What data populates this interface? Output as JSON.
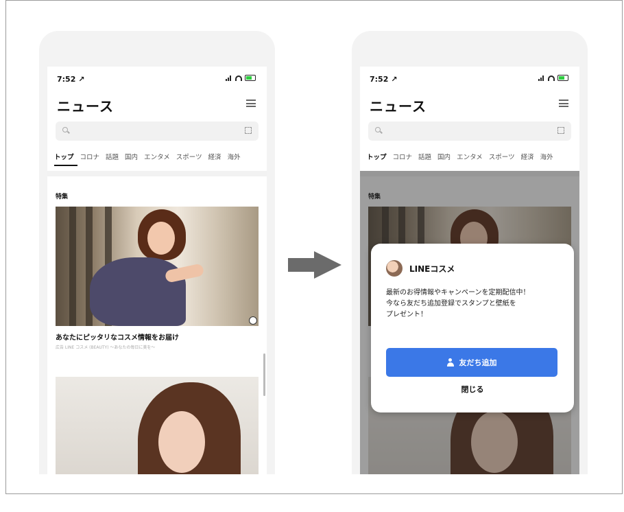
{
  "left_phone": {
    "time": "7:52",
    "title": "ニュース",
    "tabs": [
      "トップ",
      "コロナ",
      "話題",
      "国内",
      "エンタメ",
      "スポーツ",
      "経済",
      "海外"
    ],
    "active_tab": "トップ",
    "section_label": "特集",
    "caption": "あなたにピッタリなコスメ情報をお届け",
    "source": "広告 LINE コスメ (BEAUTY) 〜あなたの毎日に美を〜"
  },
  "right_phone": {
    "time": "7:52",
    "title": "ニュース",
    "tabs": [
      "トップ",
      "コロナ",
      "話題",
      "国内",
      "エンタメ",
      "スポーツ",
      "経済",
      "海外"
    ],
    "section_label": "特集",
    "popup": {
      "account_name": "LINEコスメ",
      "message_line1": "最新のお得情報やキャンペーンを定期配信中！",
      "message_line2": "今なら友だち追加登録でスタンプと壁紙を",
      "message_line3": "プレゼント！",
      "add_friend_label": "友だち追加",
      "close_label": "閉じる",
      "button_color": "#3b78e7"
    }
  }
}
